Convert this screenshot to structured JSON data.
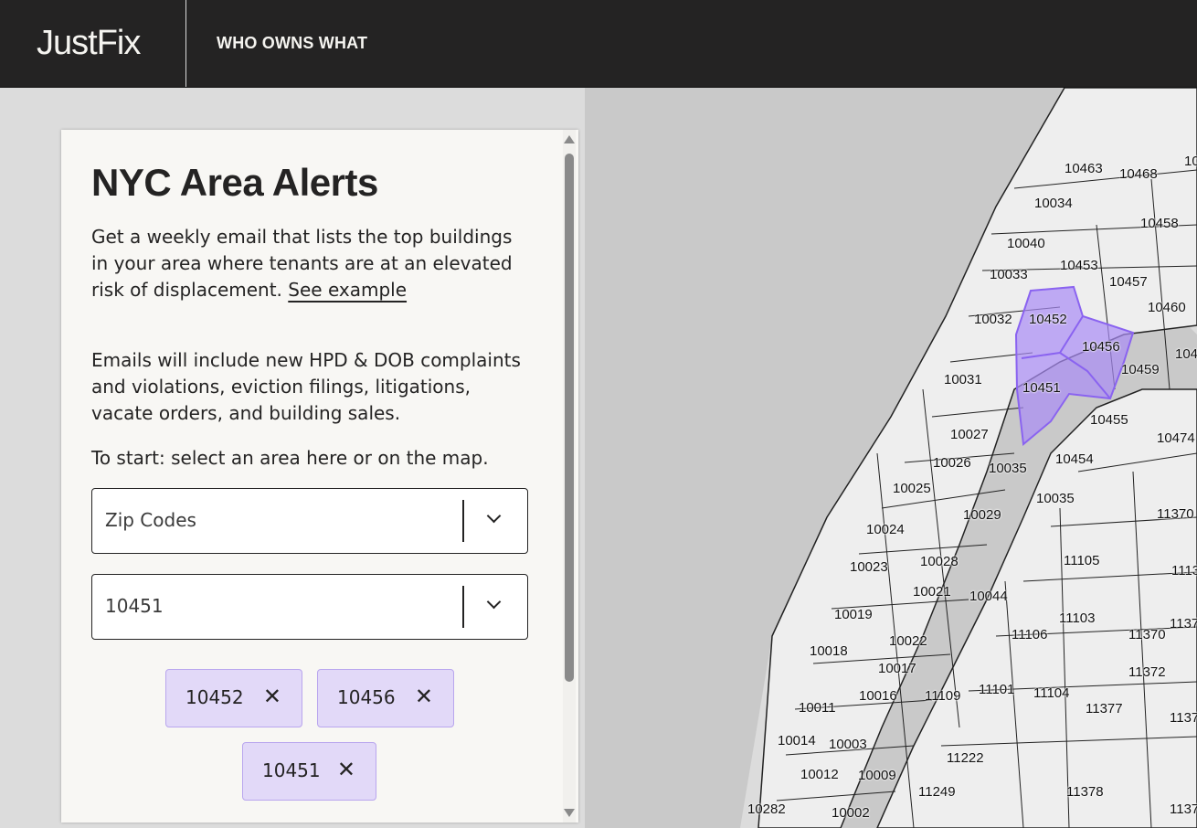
{
  "header": {
    "logo": "JustFix",
    "nav_title": "WHO OWNS WHAT"
  },
  "panel": {
    "title": "NYC Area Alerts",
    "intro_text": "Get a weekly email that lists the top buildings in your area where tenants are at an elevated risk of displacement.",
    "see_example_link": "See example",
    "emails_text": "Emails will include new HPD & DOB complaints and violations, eviction filings, litigations, vacate orders, and building sales.",
    "start_text": "To start: select an area here or on the map.",
    "area_type_select": {
      "value": "Zip Codes"
    },
    "area_value_select": {
      "value": "10451"
    },
    "selected_chips": [
      {
        "label": "10452",
        "remove_glyph": "✕"
      },
      {
        "label": "10456",
        "remove_glyph": "✕"
      },
      {
        "label": "10451",
        "remove_glyph": "✕"
      }
    ]
  },
  "map": {
    "highlight_color": "#a98cf5",
    "selected_zips": [
      "10452",
      "10456",
      "10451"
    ],
    "zip_labels": [
      "10463",
      "10468",
      "10034",
      "10458",
      "10040",
      "10453",
      "10033",
      "10457",
      "10460",
      "10032",
      "10452",
      "10456",
      "10459",
      "10031",
      "10451",
      "10455",
      "10027",
      "10474",
      "10026",
      "10035",
      "10454",
      "10025",
      "10029",
      "10035",
      "11370",
      "10024",
      "11105",
      "10028",
      "10023",
      "1113",
      "10021",
      "10044",
      "11103",
      "10019",
      "11106",
      "11370",
      "10022",
      "10018",
      "10017",
      "11372",
      "10016",
      "11109",
      "11101",
      "11104",
      "10011",
      "11377",
      "10014",
      "10003",
      "11222",
      "10012",
      "10009",
      "11249",
      "11378",
      "10282",
      "10002",
      "1137",
      "1137",
      "1137",
      "10",
      "104",
      "1104"
    ]
  }
}
